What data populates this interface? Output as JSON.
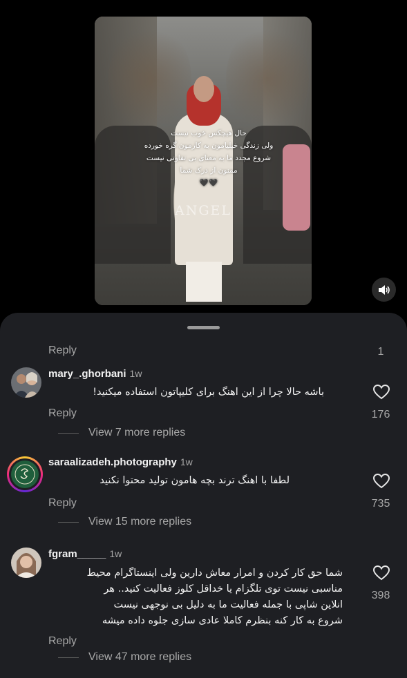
{
  "reel": {
    "overlay_lines": [
      "حال هیچکس خوب نیست",
      "ولی زندگی خیلیامون به کارمون گره خورده",
      "شروع مجدد ما به معنای بی تفاوتی نیست",
      "ممنون از درک شما",
      "🖤🖤"
    ],
    "watermark": "ANGEL",
    "sound_icon": "speaker-icon"
  },
  "top_reply": {
    "reply_label": "Reply",
    "count": "1"
  },
  "comments": [
    {
      "username": "mary_.ghorbani",
      "time": "1w",
      "text": "باشه حالا چرا از این اهنگ برای کلیپاتون استفاده میکنید!",
      "reply_label": "Reply",
      "likes": "176",
      "view_more": "View 7 more replies"
    },
    {
      "username": "saraalizadeh.photography",
      "time": "1w",
      "text": "لطفا با اهنگ ترند بچه هامون  تولید محتوا نکنید",
      "reply_label": "Reply",
      "likes": "735",
      "view_more": "View 15 more replies"
    },
    {
      "username": "fgram_____",
      "time": "1w",
      "text_lines": [
        "شما حق کار کردن و امرار معاش دارین ولی اینستاگرام محیط",
        "مناسبی نیست توی تلگزام یا خداقل کلوز فعالیت کنید.. هر",
        "انلاین شاپی با جمله فعالیت ما به دلیل بی نوجهی نیست",
        "شروع به کار کنه بنظرم کاملا عادی سازی جلوه داده میشه"
      ],
      "reply_label": "Reply",
      "likes": "398",
      "view_more": "View 47 more replies"
    }
  ],
  "colors": {
    "sheet_bg": "#1e1f23",
    "text_primary": "#f2f2f2",
    "text_secondary": "#a8a8a8"
  }
}
